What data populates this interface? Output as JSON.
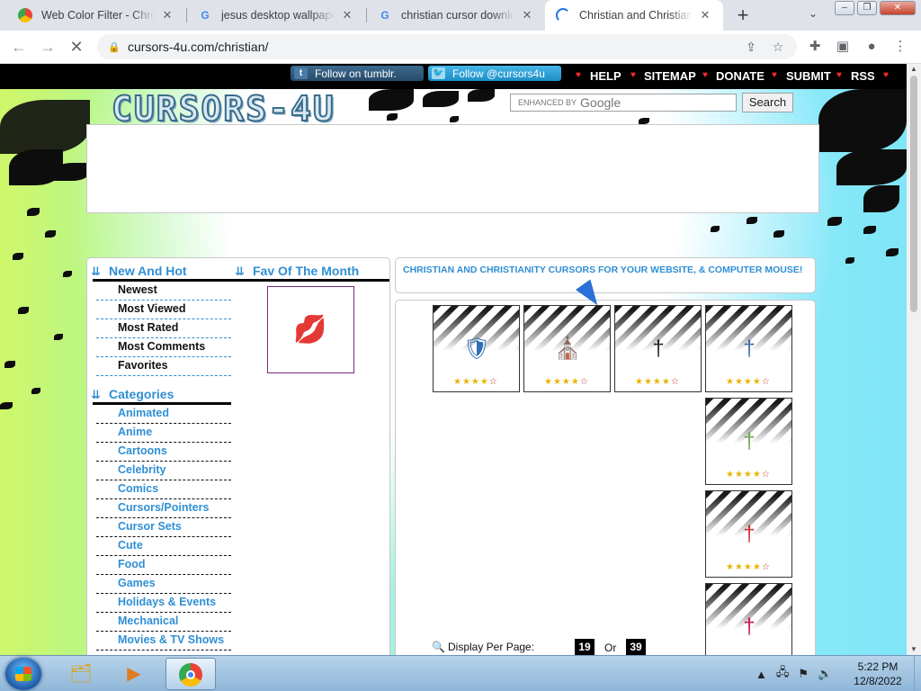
{
  "browser": {
    "tabs": [
      {
        "title": "Web Color Filter - Chrome",
        "favicon": "rainbow-icon"
      },
      {
        "title": "jesus desktop wallpaper",
        "favicon": "google-icon"
      },
      {
        "title": "christian cursor download",
        "favicon": "google-icon"
      },
      {
        "title": "Christian and Christianity",
        "favicon": "loading-spinner-icon",
        "active": true
      }
    ],
    "url": "cursors-4u.com/christian/",
    "close_symbol": "✕",
    "new_tab_symbol": "+",
    "tab_search_symbol": "⌄"
  },
  "site": {
    "follow_tumblr": "Follow on tumblr.",
    "follow_twitter": "Follow @cursors4u",
    "nav": [
      "HELP",
      "SITEMAP",
      "DONATE",
      "SUBMIT",
      "RSS"
    ],
    "logo": "CURSORS-4U",
    "search_brand": "ENHANCED BY",
    "search_google": "Google",
    "search_button": "Search"
  },
  "left": {
    "new_and_hot": "New And Hot",
    "fav_of_month": "Fav Of The Month",
    "quick_links": [
      "Newest",
      "Most Viewed",
      "Most Rated",
      "Most Comments",
      "Favorites"
    ],
    "categories_title": "Categories",
    "categories": [
      "Animated",
      "Anime",
      "Cartoons",
      "Celebrity",
      "Comics",
      "Cursors/Pointers",
      "Cursor Sets",
      "Cute",
      "Food",
      "Games",
      "Holidays & Events",
      "Mechanical",
      "Movies & TV Shows"
    ]
  },
  "main": {
    "title": "CHRISTIAN AND CHRISTIANITY CURSORS FOR YOUR WEBSITE, & COMPUTER MOUSE!",
    "cursors": [
      {
        "icon": "shield-cross-icon",
        "rating": 4
      },
      {
        "icon": "cathedral-icon",
        "rating": 4
      },
      {
        "icon": "sword-cross-icon",
        "rating": 4
      },
      {
        "icon": "blue-sword-icon",
        "rating": 4
      },
      {
        "icon": "green-sword-icon",
        "rating": 4
      },
      {
        "icon": "red-sword-icon",
        "rating": 4
      },
      {
        "icon": "pink-sword-icon",
        "rating": 4
      }
    ],
    "display_per_page": "Display Per Page:",
    "per_page_options": [
      "19",
      "39"
    ],
    "or_text": "Or"
  },
  "taskbar": {
    "time": "5:22 PM",
    "date": "12/8/2022"
  }
}
